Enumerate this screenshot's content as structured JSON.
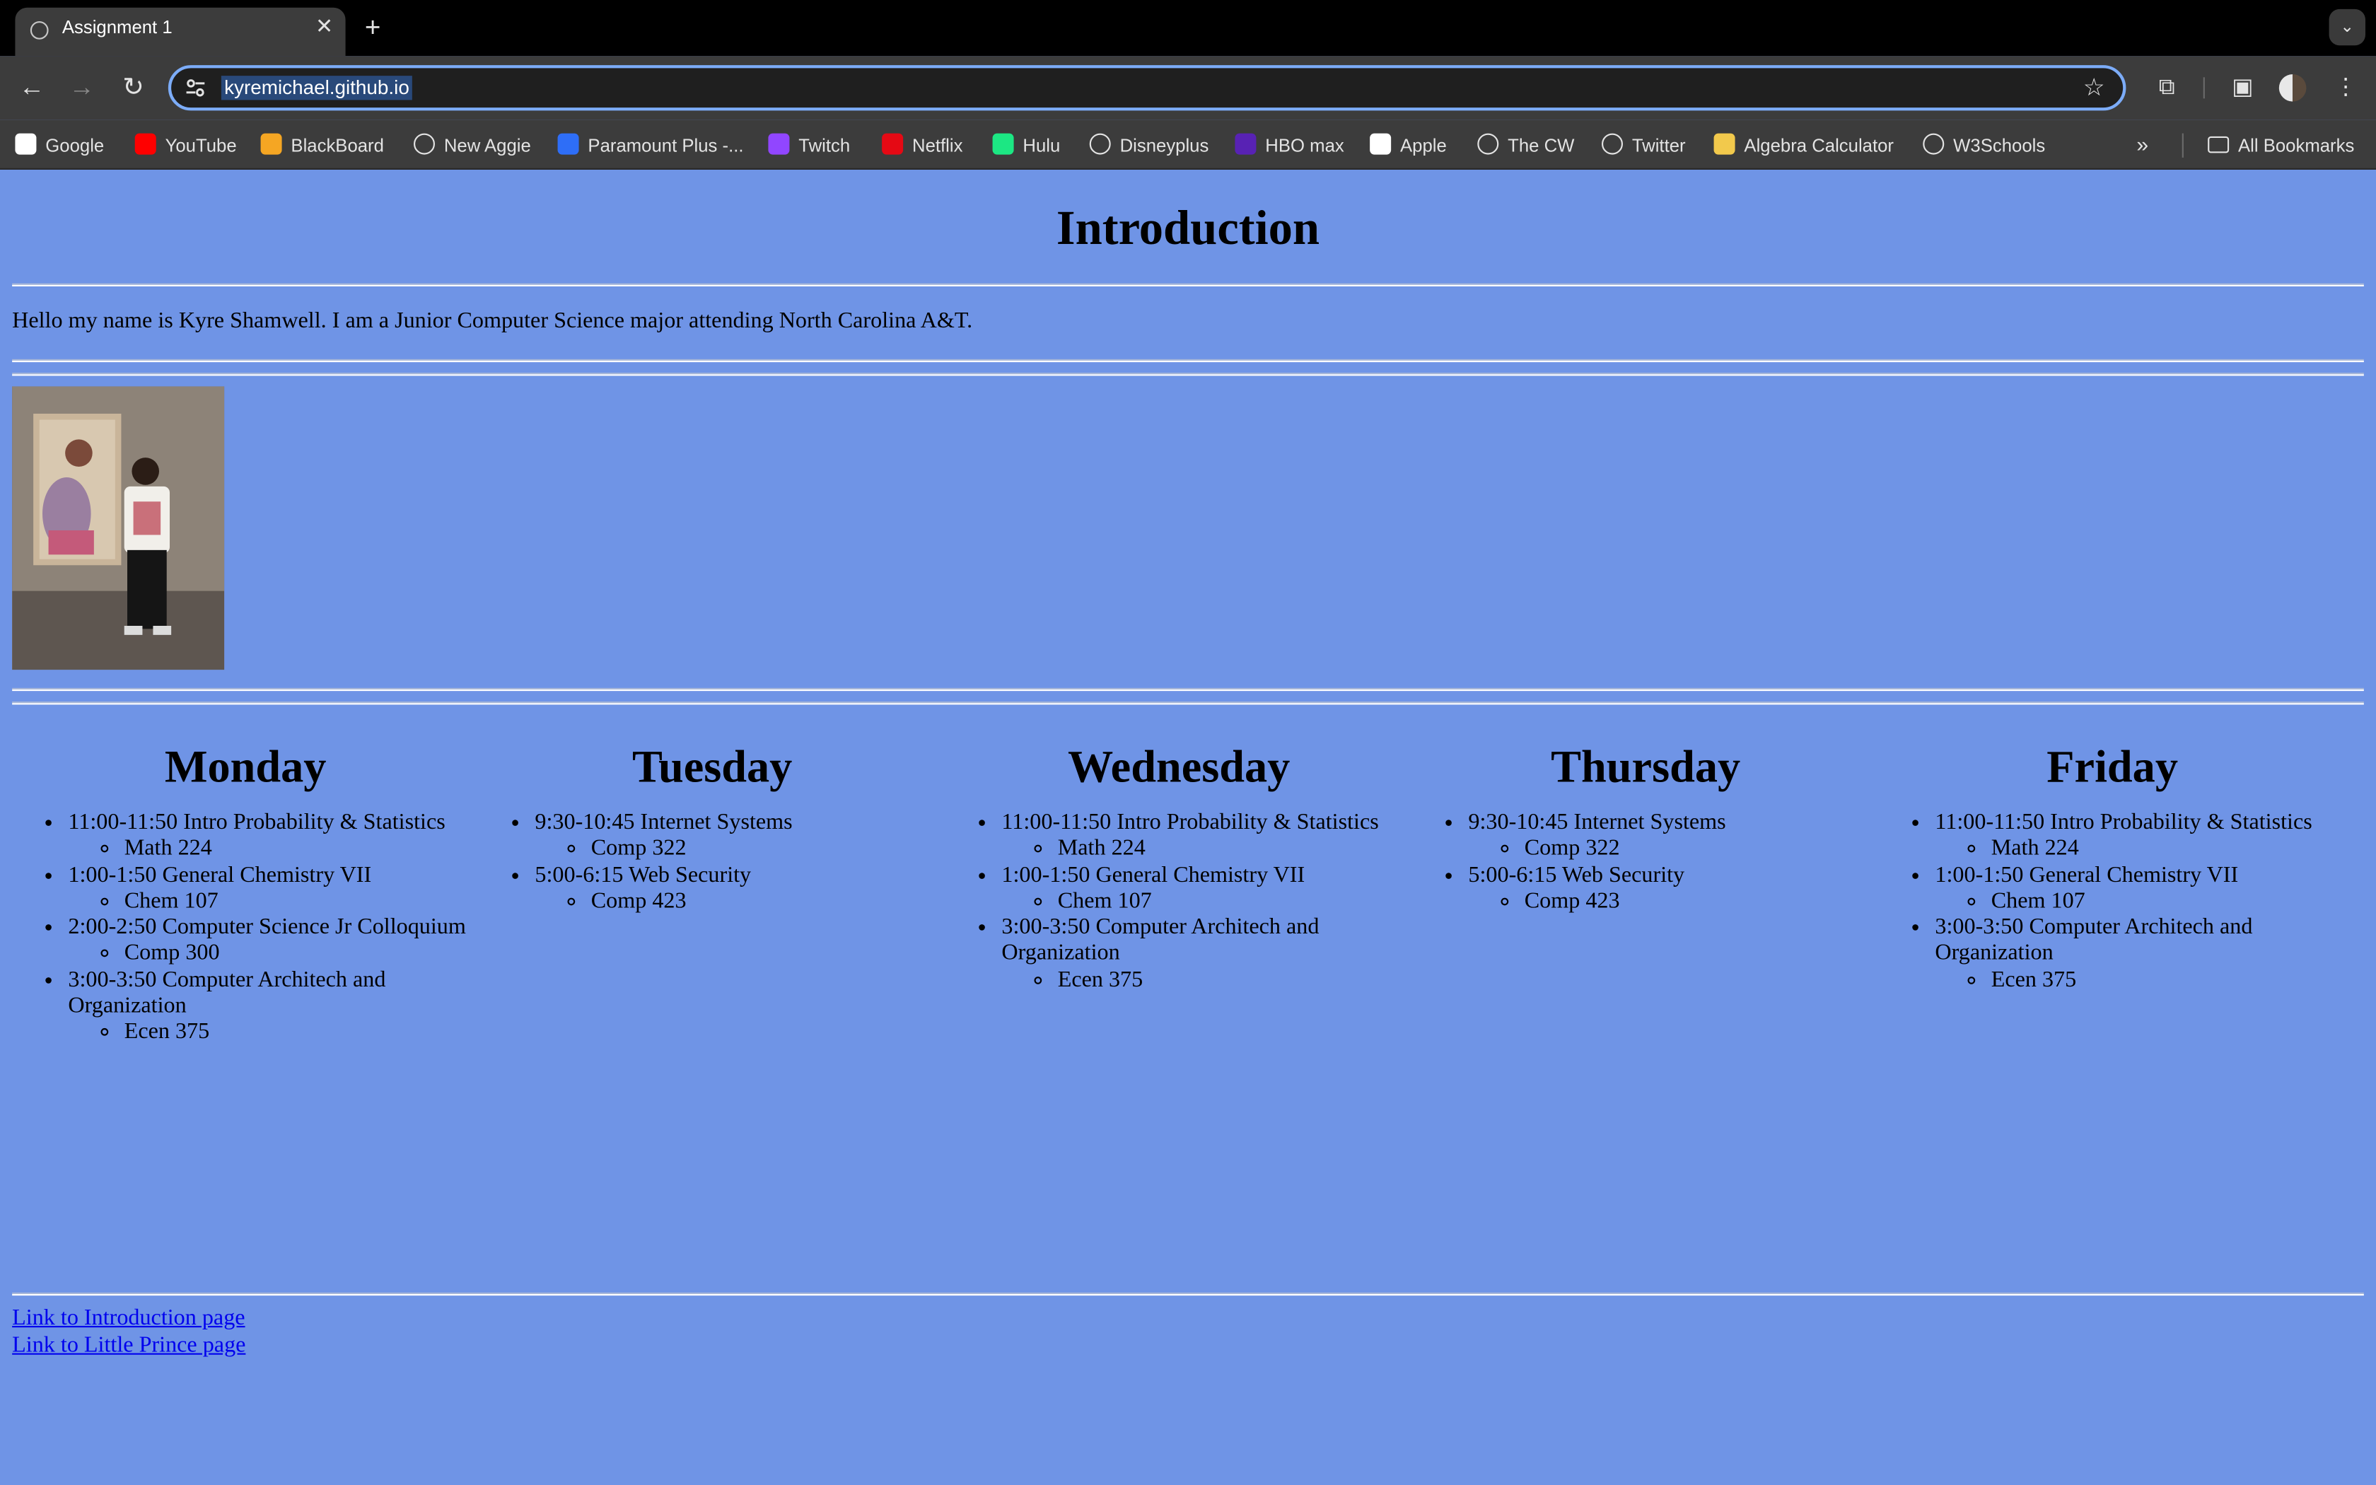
{
  "browser": {
    "tab_title": "Assignment 1",
    "url": "kyremichael.github.io",
    "bookmarks": [
      {
        "label": "Google",
        "icon": "google-icon",
        "color": "#ffffff"
      },
      {
        "label": "YouTube",
        "icon": "youtube-icon",
        "color": "#ff0000"
      },
      {
        "label": "BlackBoard",
        "icon": "blackboard-icon",
        "color": "#f5a623"
      },
      {
        "label": "New Aggie",
        "icon": "globe-icon",
        "color": "#e3e3e3"
      },
      {
        "label": "Paramount Plus -...",
        "icon": "paramount-icon",
        "color": "#2e6ef7"
      },
      {
        "label": "Twitch",
        "icon": "twitch-icon",
        "color": "#9146ff"
      },
      {
        "label": "Netflix",
        "icon": "netflix-icon",
        "color": "#e50914"
      },
      {
        "label": "Hulu",
        "icon": "hulu-icon",
        "color": "#1ce783"
      },
      {
        "label": "Disneyplus",
        "icon": "globe-icon",
        "color": "#e3e3e3"
      },
      {
        "label": "HBO max",
        "icon": "hbomax-icon",
        "color": "#5822b4"
      },
      {
        "label": "Apple",
        "icon": "apple-icon",
        "color": "#ffffff"
      },
      {
        "label": "The CW",
        "icon": "globe-icon",
        "color": "#e3e3e3"
      },
      {
        "label": "Twitter",
        "icon": "globe-icon",
        "color": "#e3e3e3"
      },
      {
        "label": "Algebra Calculator",
        "icon": "calculator-icon",
        "color": "#f2c94c"
      },
      {
        "label": "W3Schools",
        "icon": "globe-icon",
        "color": "#e3e3e3"
      }
    ],
    "all_bookmarks": "All Bookmarks"
  },
  "page": {
    "heading": "Introduction",
    "intro": "Hello my name is Kyre Shamwell. I am a Junior Computer Science major attending North Carolina A&T.",
    "days": [
      {
        "name": "Monday",
        "classes": [
          {
            "time": "11:00-11:50 Intro Probability & Statistics",
            "course": "Math 224"
          },
          {
            "time": "1:00-1:50 General Chemistry VII",
            "course": "Chem 107"
          },
          {
            "time": "2:00-2:50 Computer Science Jr Colloquium",
            "course": "Comp 300"
          },
          {
            "time": "3:00-3:50 Computer Architech and Organization",
            "course": "Ecen 375"
          }
        ]
      },
      {
        "name": "Tuesday",
        "classes": [
          {
            "time": "9:30-10:45 Internet Systems",
            "course": "Comp 322"
          },
          {
            "time": "5:00-6:15 Web Security",
            "course": "Comp 423"
          }
        ]
      },
      {
        "name": "Wednesday",
        "classes": [
          {
            "time": "11:00-11:50 Intro Probability & Statistics",
            "course": "Math 224"
          },
          {
            "time": "1:00-1:50 General Chemistry VII",
            "course": "Chem 107"
          },
          {
            "time": "3:00-3:50 Computer Architech and Organization",
            "course": "Ecen 375"
          }
        ]
      },
      {
        "name": "Thursday",
        "classes": [
          {
            "time": "9:30-10:45 Internet Systems",
            "course": "Comp 322"
          },
          {
            "time": "5:00-6:15 Web Security",
            "course": "Comp 423"
          }
        ]
      },
      {
        "name": "Friday",
        "classes": [
          {
            "time": "11:00-11:50 Intro Probability & Statistics",
            "course": "Math 224"
          },
          {
            "time": "1:00-1:50 General Chemistry VII",
            "course": "Chem 107"
          },
          {
            "time": "3:00-3:50 Computer Architech and Organization",
            "course": "Ecen 375"
          }
        ]
      }
    ],
    "links": [
      {
        "label": "Link to Introduction page"
      },
      {
        "label": "Link to Little Prince page"
      }
    ],
    "background_color": "#6f94e6",
    "link_color": "#0000ee"
  }
}
